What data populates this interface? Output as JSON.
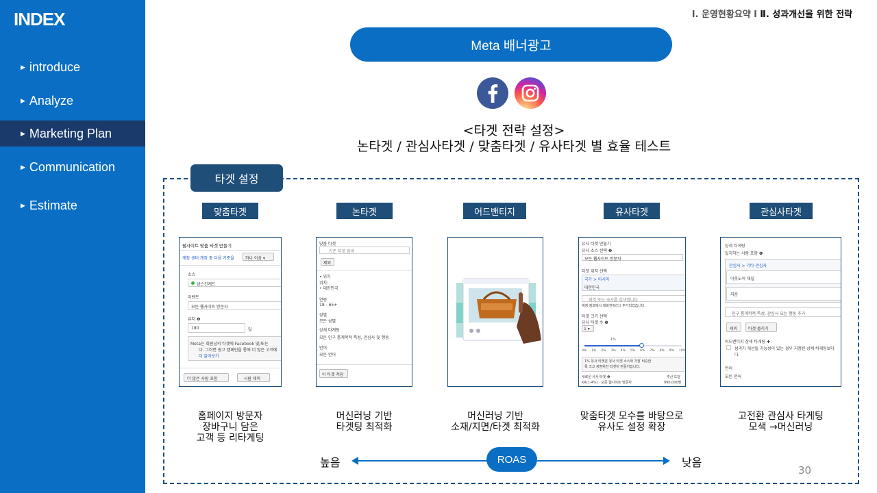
{
  "sidebar": {
    "title": "INDEX",
    "items": [
      {
        "label": "introduce"
      },
      {
        "label": "Analyze"
      },
      {
        "label": "Marketing Plan"
      },
      {
        "label": "Communication"
      },
      {
        "label": "Estimate"
      }
    ],
    "active_color": "#1a3a6b",
    "bg_color": "#0a6fc4"
  },
  "breadcrumb": {
    "part1": "Ⅰ. 운영현황요약 l",
    "part2": "Ⅱ. 성과개선을 위한 전략"
  },
  "header": {
    "title": "Meta 배너광고"
  },
  "icons": {
    "facebook": "facebook-icon",
    "instagram": "instagram-icon"
  },
  "strategy": {
    "line1": "<타겟 전략 설정>",
    "line2": "논타겟 / 관심사타겟 / 맞춤타겟 / 유사타겟 별 효율 테스트"
  },
  "target_tab": "타겟 설정",
  "columns": [
    {
      "label": "맞춤타겟",
      "desc": [
        "홈페이지 방문자",
        "장바구니 담은",
        "고객 등 리타게팅"
      ],
      "shot": {
        "title": "웹사이트 맞춤 타겟 만들기",
        "row1": "계정 센터 계정 중 다음 기준을",
        "select": "하나 이상 ▾",
        "source_label": "소스",
        "source_value": "샴스킨케드",
        "event_label": "이벤트",
        "event_value": "모든 웹사이트 방문자",
        "retention_label": "유지 ❶",
        "retention_value": "180",
        "retention_unit": "일",
        "note1": "Meta는 회원님의 타겟에 Facebook 및/또는",
        "note2": "다. 그러면 광고 캠페인을 통해 더 많은 고객에",
        "note_link": "더 알아보기",
        "btn1": "더 많은 사람 포함",
        "btn2": "사람 제외"
      }
    },
    {
      "label": "논타겟",
      "desc": [
        "머신러닝 기반",
        "타겟팅 최적화"
      ],
      "shot": {
        "title": "맞춤 타겟",
        "search": "기존 타겟 검색",
        "exclude": "제외",
        "loc_h": "• 위치",
        "loc_l": "위치:",
        "loc_v": "• 대한민국",
        "age_l": "연령",
        "age_v": "18 - 65+",
        "gender_l": "성별",
        "gender_v": "모든 성별",
        "detail_l": "상세 타게팅",
        "detail_v": "모든 인구 통계학적 특성, 관심사 및 행동",
        "lang_l": "언어",
        "lang_v": "모든 언어",
        "save": "이 타겟 저장"
      }
    },
    {
      "label": "어드밴티지",
      "desc": [
        "머신러닝 기반",
        "소재/지면/타겟 최적화"
      ]
    },
    {
      "label": "유사타겟",
      "desc": [
        "맞춤타겟 모수를 바탕으로",
        "유사도 설정 확장"
      ],
      "shot": {
        "title": "유사 타겟 만들기",
        "src_l": "유사 소스 선택 ❶",
        "src_v": "모든 웹사이트 방문자",
        "loc_l": "타겟 위치 선택",
        "loc_tag": "국가 > 아시아",
        "loc_v": "대한민국",
        "search": "지역 또는 국가를 검색합니다",
        "hint": "계정 정보에서 대화전략(다) 추가되었습니다.",
        "size_l": "타겟 크기 선택",
        "count_l": "유사 타겟 수 ❶",
        "count_v": "1 ▾",
        "ticks": [
          "0%",
          "1%",
          "2%",
          "3%",
          "4%",
          "5%",
          "6%",
          "7%",
          "8%",
          "9%",
          "10%"
        ],
        "slider_label": "1%",
        "note1": "1% 유사 타겟은 유사 타겟 소스와 가장 비슷한",
        "note2": "록 크고 광범위한 타겟이 만들어집니다.",
        "new_l": "새로운 유사 타겟 ❶",
        "new_v": "KR(1-4%) · 모든 웹사이트 방문자",
        "est_l": "추산 도달",
        "est_v": "990,000명"
      }
    },
    {
      "label": "관심사타겟",
      "desc": [
        "고전환 관심사 타게팅",
        "모색 →머신러닝"
      ],
      "shot": {
        "title": "상세 타게팅",
        "sub": "일치하는 사람 포함 ❶",
        "crumb": "관심사 > 기타 관심사",
        "item1": "아웃도어 채널",
        "item2": "지갑",
        "search": "인구 통계학적 특성, 관심사 또는 행동 추가",
        "exclude": "제외",
        "narrow": "타겟 좁히기",
        "adv": "어드밴티지 상세 타게팅 ✚",
        "adv_desc1": "성과가 개선될 가능성이 있는 경우 지정된 상세 타게팅보다",
        "adv_desc2": "다.",
        "lang_l": "언어",
        "lang_v": "모든 언어"
      }
    }
  ],
  "roas": {
    "left": "높음",
    "center": "ROAS",
    "right": "낮음"
  },
  "page_number": "30"
}
